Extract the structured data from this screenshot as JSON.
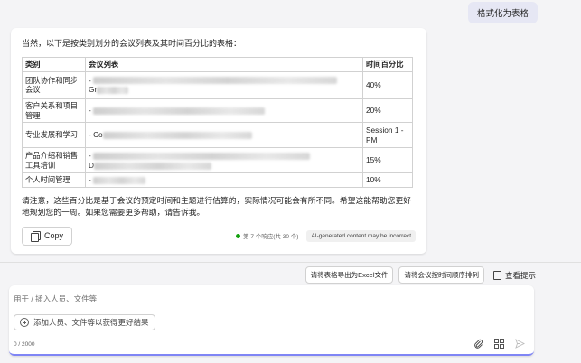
{
  "user_message": "格式化为表格",
  "answer": {
    "intro": "当然，以下是按类别划分的会议列表及其时间百分比的表格：",
    "table": {
      "headers": [
        "类别",
        "会议列表",
        "时间百分比"
      ],
      "rows": [
        {
          "category": "团队协作和同步会议",
          "meetings": "- ",
          "meetings_tail": "Gr",
          "percent": "40%"
        },
        {
          "category": "客户关系和项目管理",
          "meetings": "- ",
          "meetings_tail": "",
          "percent": "20%"
        },
        {
          "category": "专业发展和学习",
          "meetings": "- Co",
          "meetings_tail": "",
          "percent": "Session 1 - PM"
        },
        {
          "category": "产品介绍和销售工具培训",
          "meetings": "- ",
          "meetings_tail": "D",
          "percent": "15%"
        },
        {
          "category": "个人时间管理",
          "meetings": "- ",
          "meetings_tail": "",
          "percent": "10%"
        }
      ]
    },
    "note": "请注意，这些百分比是基于会议的预定时间和主题进行估算的，实际情况可能会有所不同。希望这能帮助您更好地规划您的一周。如果您需要更多帮助，请告诉我。",
    "copy_label": "Copy",
    "reference_text": "第 7 个响应(共 30 个)",
    "ai_disclaimer": "AI-generated content may be incorrect"
  },
  "suggestions": [
    "请将表格导出为Excel文件",
    "请将会议按时间顺序排列"
  ],
  "view_prompts_label": "查看提示",
  "compose": {
    "placeholder": "用于 / 插入人员、文件等",
    "add_people_label": "添加人员、文件等以获得更好结果",
    "char_counter": "0 / 2000"
  },
  "colors": {
    "accent": "#7f85f5",
    "status_dot": "#13a10e",
    "user_bubble": "#e6e7f4"
  },
  "icons": [
    "copy-icon",
    "book-icon",
    "add-circle-icon",
    "attach-icon",
    "apps-icon",
    "send-icon"
  ]
}
